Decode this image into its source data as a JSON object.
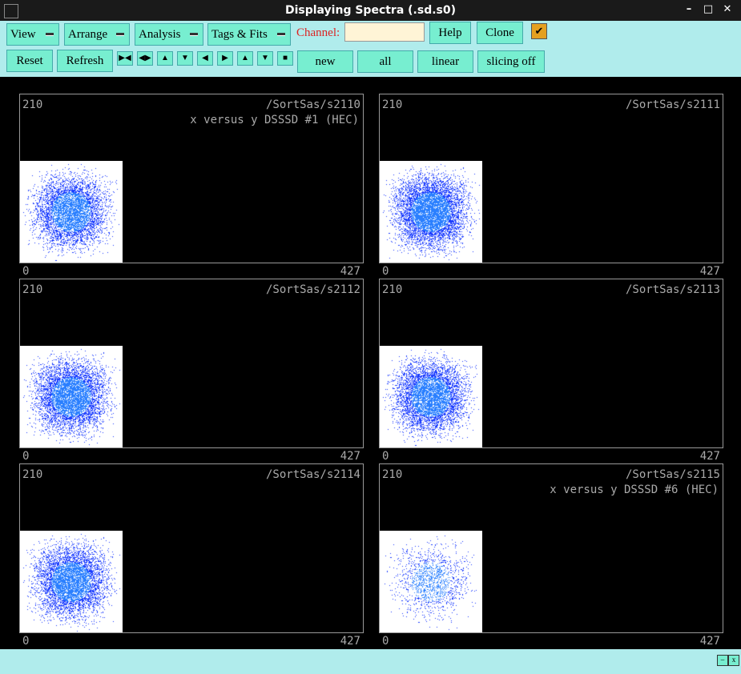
{
  "window": {
    "title": "Displaying Spectra (.sd.s0)"
  },
  "menus": [
    "View",
    "Arrange",
    "Analysis",
    "Tags & Fits"
  ],
  "channel": {
    "label": "Channel:",
    "value": ""
  },
  "top_buttons": {
    "help": "Help",
    "clone": "Clone"
  },
  "row2_buttons": {
    "reset": "Reset",
    "refresh": "Refresh",
    "new": "new",
    "all": "all",
    "linear": "linear",
    "slicing": "slicing off"
  },
  "icon_buttons": [
    "expand-h-icon",
    "shrink-h-icon",
    "expand-v-icon",
    "shrink-v-icon",
    "left-icon",
    "right-icon",
    "up-icon",
    "down-icon",
    "full-icon"
  ],
  "check_icon": "✔",
  "panes": [
    {
      "ymax": "210",
      "name": "/SortSas/s2110",
      "subtitle": "x versus y DSSSD #1 (HEC)",
      "xmin": "0",
      "xmax": "427",
      "density": 0.55
    },
    {
      "ymax": "210",
      "name": "/SortSas/s2111",
      "subtitle": "",
      "xmin": "0",
      "xmax": "427",
      "density": 0.75
    },
    {
      "ymax": "210",
      "name": "/SortSas/s2112",
      "subtitle": "",
      "xmin": "0",
      "xmax": "427",
      "density": 0.8
    },
    {
      "ymax": "210",
      "name": "/SortSas/s2113",
      "subtitle": "",
      "xmin": "0",
      "xmax": "427",
      "density": 0.75
    },
    {
      "ymax": "210",
      "name": "/SortSas/s2114",
      "subtitle": "",
      "xmin": "0",
      "xmax": "427",
      "density": 0.6
    },
    {
      "ymax": "210",
      "name": "/SortSas/s2115",
      "subtitle": "x versus y DSSSD #6 (HEC)",
      "xmin": "0",
      "xmax": "427",
      "density": 0.15
    }
  ],
  "colors": {
    "toolbar": "#b0ecec",
    "button": "#77eed0",
    "point": "#1a3cff"
  }
}
